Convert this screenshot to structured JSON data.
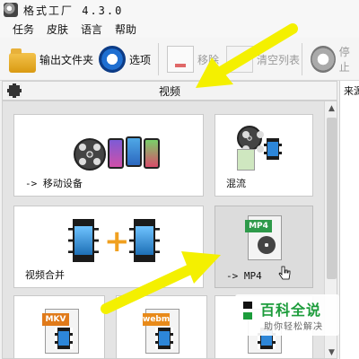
{
  "window": {
    "title": "格式工厂 4.3.0"
  },
  "menu": {
    "items": [
      "任务",
      "皮肤",
      "语言",
      "帮助"
    ]
  },
  "toolbar": {
    "output_folder_label": "输出文件夹",
    "options_label": "选项",
    "remove_label": "移除",
    "clear_list_label": "清空列表",
    "stop_label": "停止"
  },
  "category": {
    "title": "视频"
  },
  "right_pane": {
    "label": "来源"
  },
  "tiles": {
    "mobile_device": "-> 移动设备",
    "mux": "混流",
    "video_join": "视频合并",
    "mp4": "-> MP4",
    "mkv_band": "MKV",
    "webm_band": "webm",
    "mp4_band": "MP4"
  },
  "watermark": {
    "title": "百科全说",
    "subtitle": "助你轻松解决"
  },
  "colors": {
    "annotation_arrow": "#f4f000",
    "brand_green": "#1c9c3b",
    "mkv_band": "#e07a1a",
    "webm_band": "#e88a1a",
    "mp4_band": "#2e9a4a"
  }
}
